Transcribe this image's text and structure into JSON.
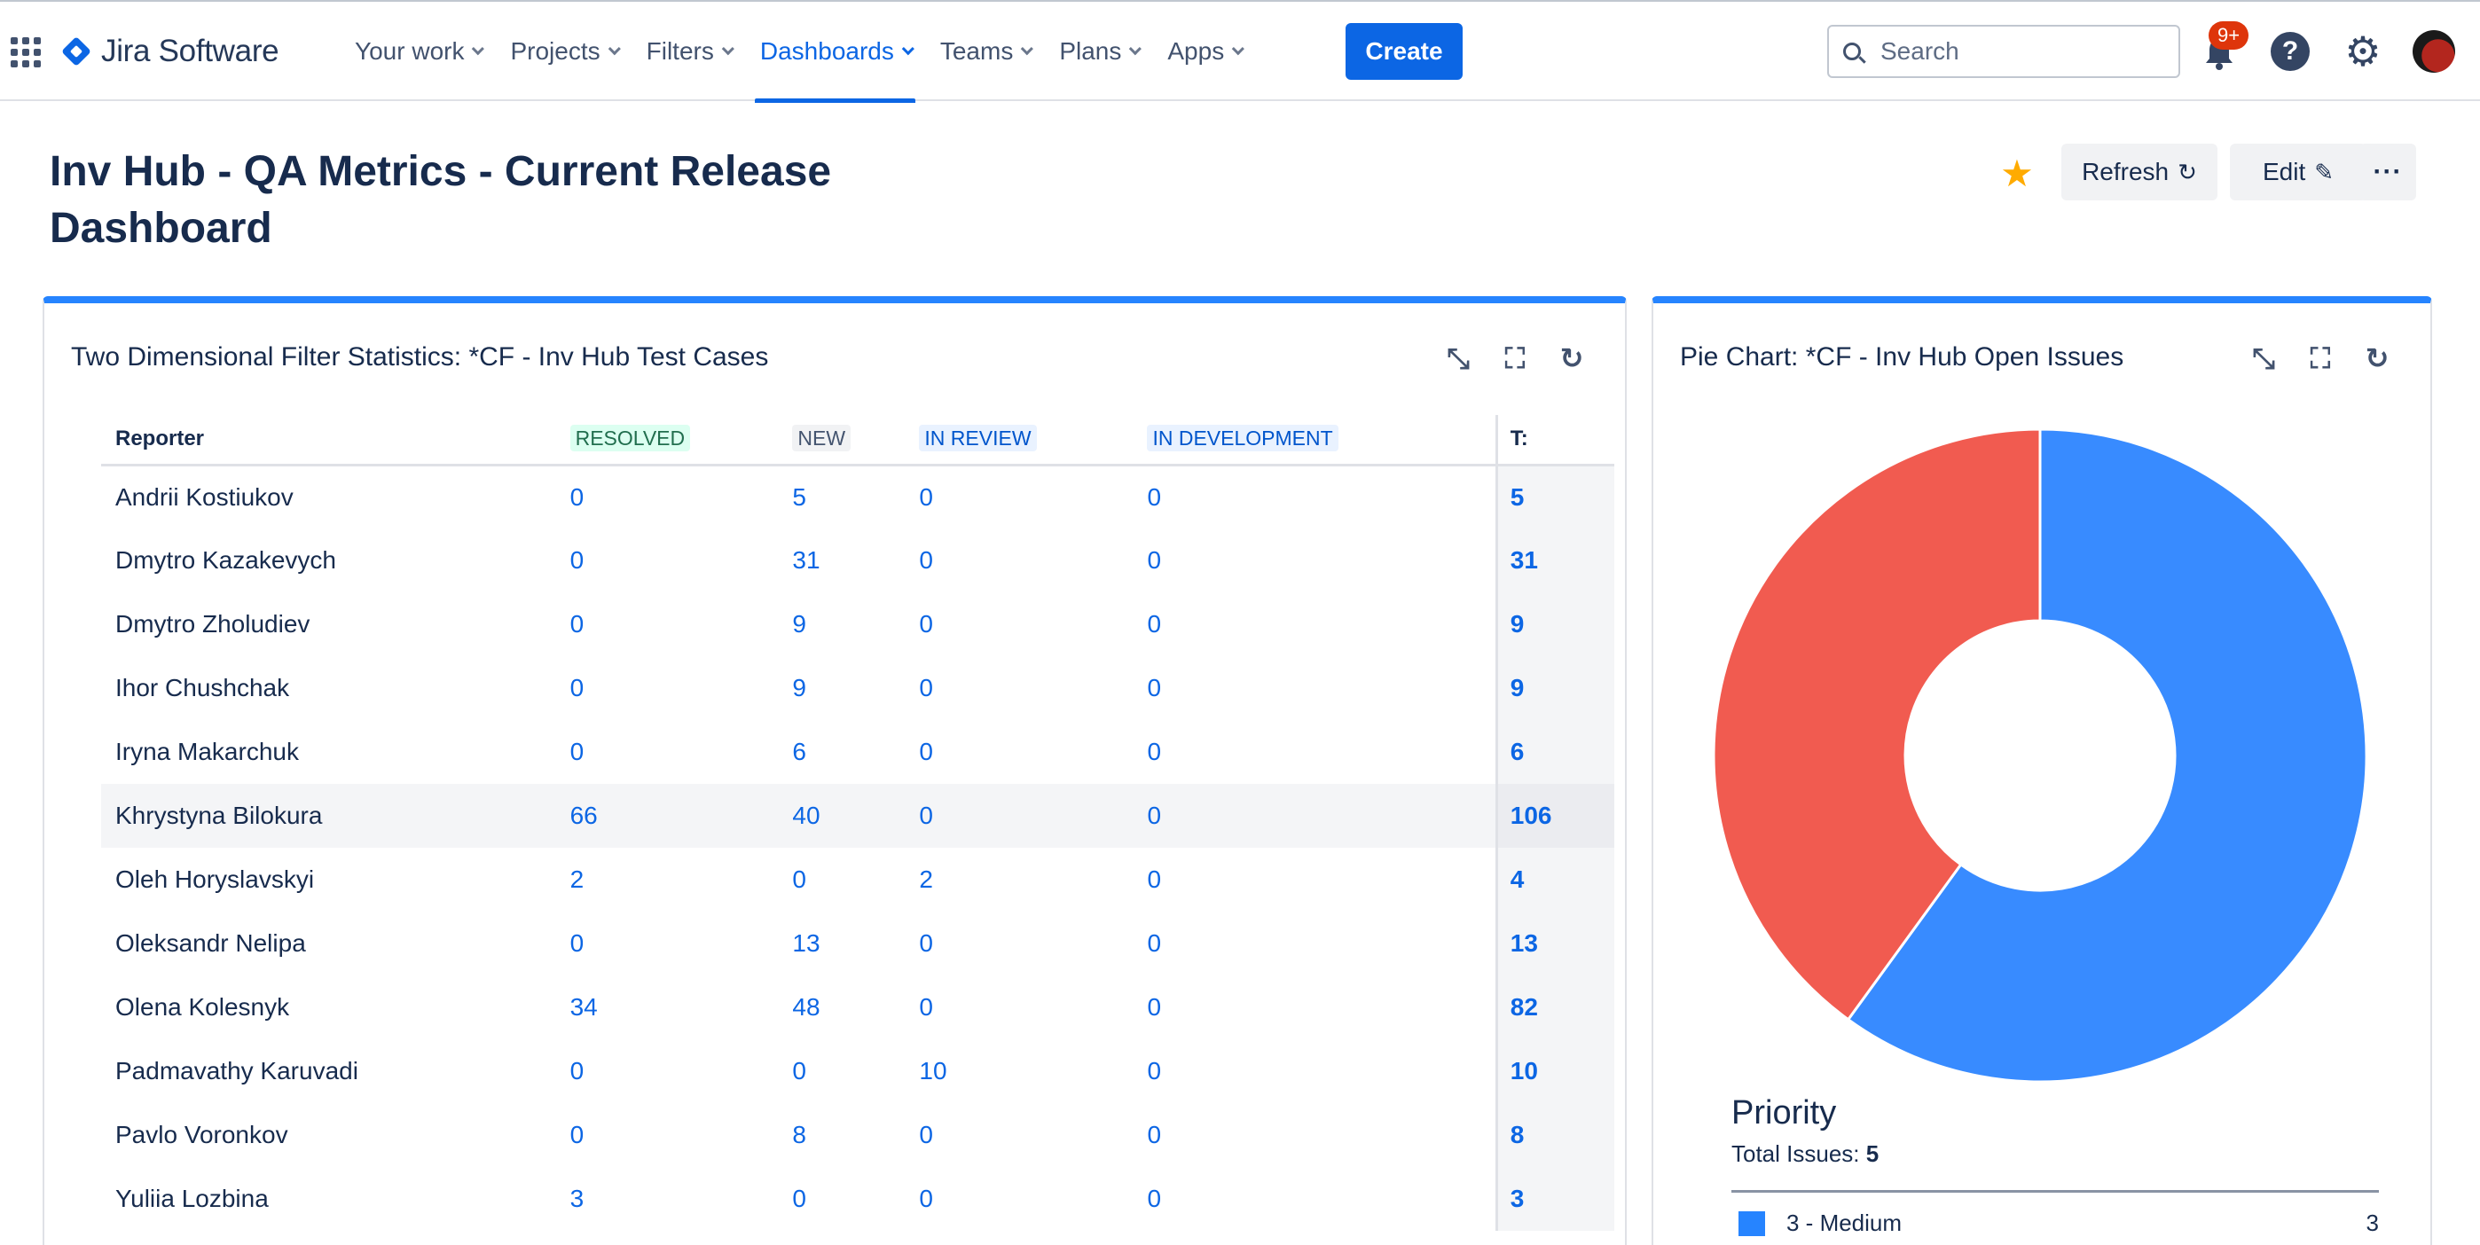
{
  "header": {
    "logo_text": "Jira Software",
    "nav": [
      {
        "label": "Your work"
      },
      {
        "label": "Projects"
      },
      {
        "label": "Filters"
      },
      {
        "label": "Dashboards"
      },
      {
        "label": "Teams"
      },
      {
        "label": "Plans"
      },
      {
        "label": "Apps"
      }
    ],
    "active_nav": "Dashboards",
    "create_label": "Create",
    "search_placeholder": "Search",
    "notification_badge": "9+"
  },
  "page": {
    "title": "Inv Hub - QA Metrics - Current Release Dashboard",
    "refresh_label": "Refresh",
    "edit_label": "Edit",
    "more_label": "···"
  },
  "gadget_table": {
    "title": "Two Dimensional Filter Statistics: *CF - Inv Hub Test Cases",
    "columns": [
      "Reporter",
      "RESOLVED",
      "NEW",
      "IN REVIEW",
      "IN DEVELOPMENT",
      "T:"
    ],
    "rows": [
      {
        "name": "Andrii Kostiukov",
        "resolved": "0",
        "new": "5",
        "review": "0",
        "dev": "0",
        "total": "5"
      },
      {
        "name": "Dmytro Kazakevych",
        "resolved": "0",
        "new": "31",
        "review": "0",
        "dev": "0",
        "total": "31"
      },
      {
        "name": "Dmytro Zholudiev",
        "resolved": "0",
        "new": "9",
        "review": "0",
        "dev": "0",
        "total": "9"
      },
      {
        "name": "Ihor Chushchak",
        "resolved": "0",
        "new": "9",
        "review": "0",
        "dev": "0",
        "total": "9"
      },
      {
        "name": "Iryna Makarchuk",
        "resolved": "0",
        "new": "6",
        "review": "0",
        "dev": "0",
        "total": "6"
      },
      {
        "name": "Khrystyna Bilokura",
        "resolved": "66",
        "new": "40",
        "review": "0",
        "dev": "0",
        "total": "106"
      },
      {
        "name": "Oleh Horyslavskyi",
        "resolved": "2",
        "new": "0",
        "review": "2",
        "dev": "0",
        "total": "4"
      },
      {
        "name": "Oleksandr Nelipa",
        "resolved": "0",
        "new": "13",
        "review": "0",
        "dev": "0",
        "total": "13"
      },
      {
        "name": "Olena Kolesnyk",
        "resolved": "34",
        "new": "48",
        "review": "0",
        "dev": "0",
        "total": "82"
      },
      {
        "name": "Padmavathy Karuvadi",
        "resolved": "0",
        "new": "0",
        "review": "10",
        "dev": "0",
        "total": "10"
      },
      {
        "name": "Pavlo Voronkov",
        "resolved": "0",
        "new": "8",
        "review": "0",
        "dev": "0",
        "total": "8"
      },
      {
        "name": "Yuliia Lozbina",
        "resolved": "3",
        "new": "0",
        "review": "0",
        "dev": "0",
        "total": "3"
      }
    ],
    "highlighted_row": 5
  },
  "gadget_pie": {
    "title": "Pie Chart: *CF - Inv Hub Open Issues",
    "legend_title": "Priority",
    "total_label": "Total Issues:",
    "total_value": "5",
    "legend": [
      {
        "label": "3 - Medium",
        "count": "3",
        "color": "#2684ff"
      }
    ]
  },
  "chart_data": {
    "type": "pie",
    "donut": true,
    "title": "Pie Chart: *CF - Inv Hub Open Issues",
    "slices": [
      {
        "label": "3 - Medium",
        "value": 3,
        "color": "#388bff"
      },
      {
        "label": "",
        "value": 2,
        "color": "#f15b50"
      }
    ]
  },
  "colors": {
    "accent": "#0c66e4",
    "gadget_border": "#2684ff",
    "star": "#ffab00",
    "badge": "#de350b"
  }
}
